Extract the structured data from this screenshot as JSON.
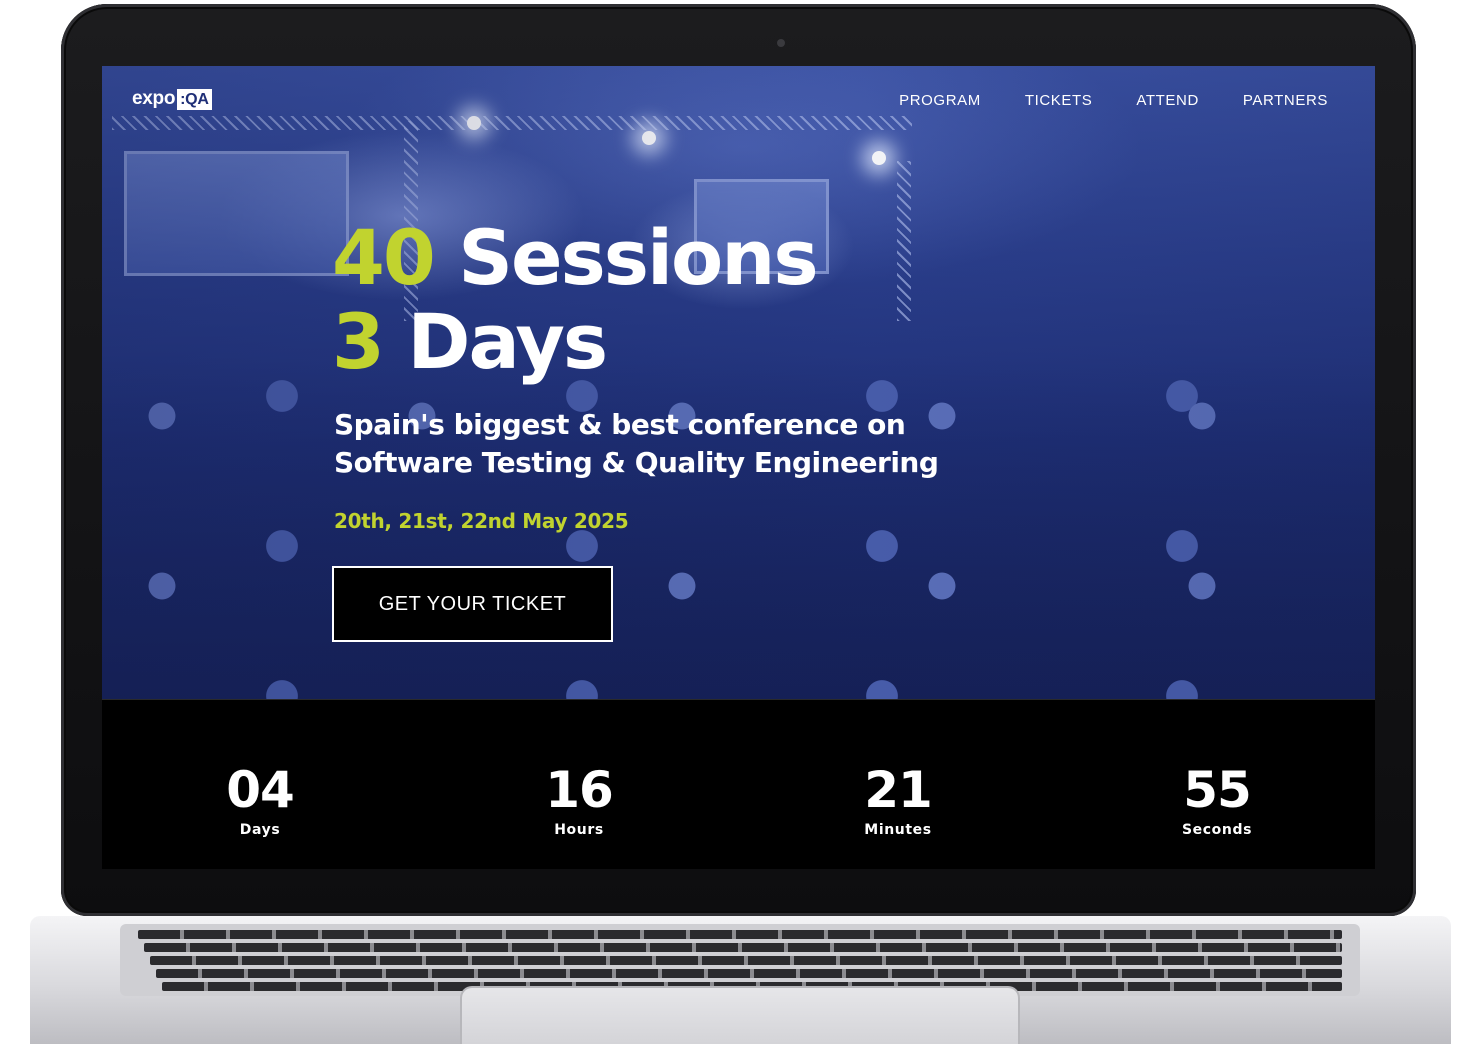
{
  "brand": {
    "logo_text": "expo",
    "logo_box": ":QA"
  },
  "nav": {
    "items": [
      "PROGRAM",
      "TICKETS",
      "ATTEND",
      "PARTNERS"
    ]
  },
  "hero": {
    "line1_accent": "40",
    "line1_text": "Sessions",
    "line2_accent": "3",
    "line2_text": "Days",
    "subtitle_line1": "Spain's biggest & best conference on",
    "subtitle_line2": "Software Testing & Quality Engineering",
    "dates": "20th, 21st, 22nd May 2025",
    "cta_label": "GET YOUR TICKET"
  },
  "countdown": {
    "items": [
      {
        "value": "04",
        "label": "Days"
      },
      {
        "value": "16",
        "label": "Hours"
      },
      {
        "value": "21",
        "label": "Minutes"
      },
      {
        "value": "55",
        "label": "Seconds"
      }
    ]
  },
  "colors": {
    "accent": "#c1d32f",
    "hero_blue": "#2b3f8d",
    "countdown_bg": "#000000"
  }
}
